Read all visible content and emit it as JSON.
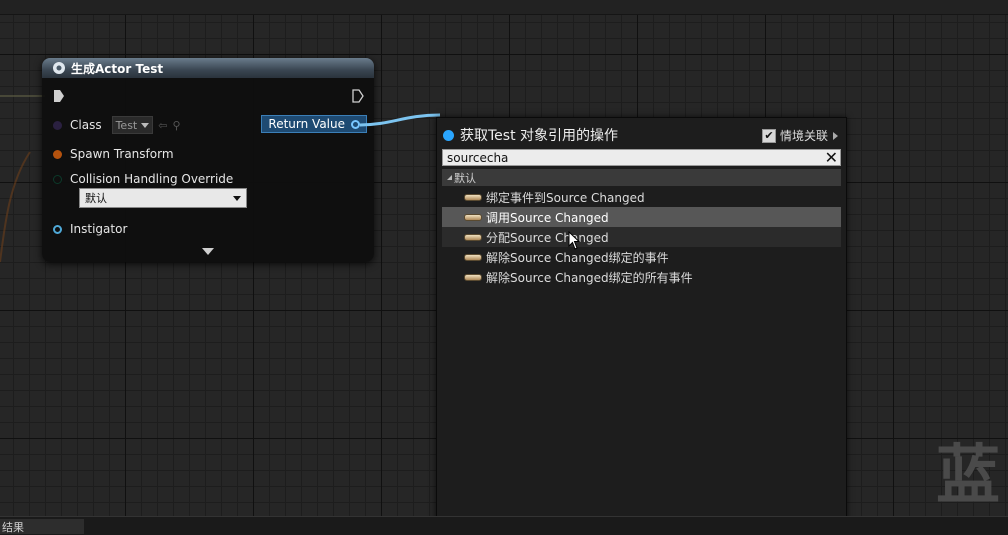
{
  "node": {
    "title": "生成Actor Test",
    "class_label": "Class",
    "class_value": "Test",
    "return_value": "Return Value",
    "spawn_transform": "Spawn Transform",
    "collision_label": "Collision Handling Override",
    "collision_value": "默认",
    "instigator": "Instigator"
  },
  "menu": {
    "title": "获取Test 对象引用的操作",
    "context_label": "情境关联",
    "context_checked": true,
    "search_value": "sourcecha",
    "category": "默认",
    "items": [
      {
        "label": "绑定事件到Source Changed"
      },
      {
        "label": "调用Source Changed"
      },
      {
        "label": "分配Source Changed"
      },
      {
        "label": "解除Source Changed绑定的事件"
      },
      {
        "label": "解除Source Changed绑定的所有事件"
      }
    ]
  },
  "bottom": {
    "results_tab": "结果"
  },
  "watermark": "蓝",
  "colors": {
    "accent": "#2aa6ff",
    "node_pin": "#79c6ff",
    "selected_row": "#575757"
  }
}
